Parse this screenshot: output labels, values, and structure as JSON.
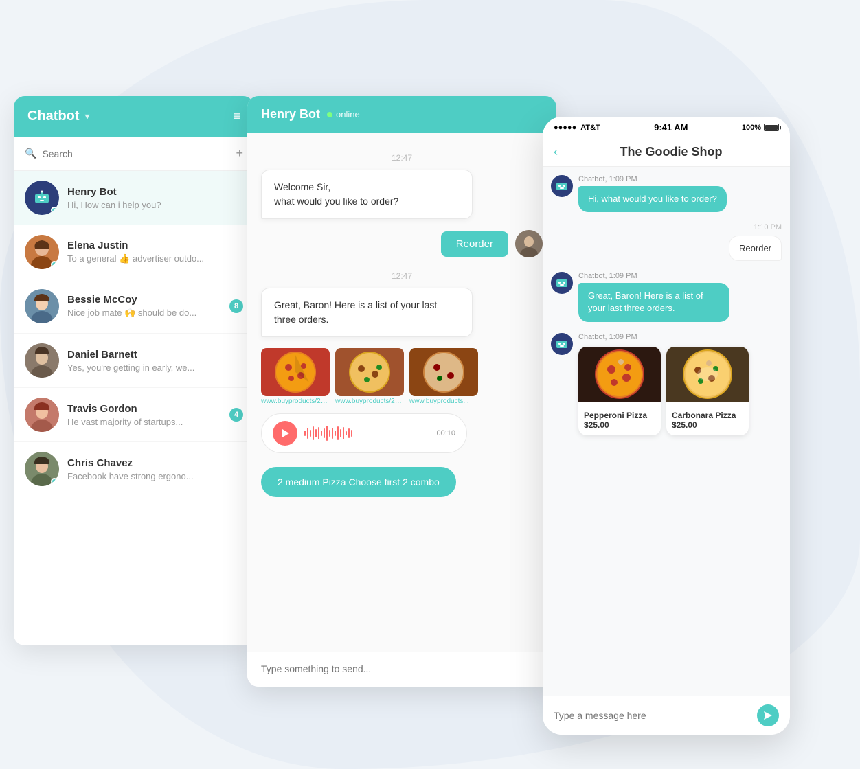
{
  "app": {
    "title": "Chatbot",
    "chevron": "▾",
    "menu_icon": "≡"
  },
  "search": {
    "placeholder": "Search"
  },
  "contacts": [
    {
      "id": "henry-bot",
      "name": "Henry Bot",
      "preview": "Hi, How can i help you?",
      "avatar_type": "bot",
      "online": true,
      "badge": null
    },
    {
      "id": "elena-justin",
      "name": "Elena Justin",
      "preview": "To a general 👍 advertiser outdo...",
      "avatar_type": "elena",
      "online": true,
      "badge": null
    },
    {
      "id": "bessie-mccoy",
      "name": "Bessie McCoy",
      "preview": "Nice job mate 🙌 should be do...",
      "avatar_type": "bessie",
      "online": false,
      "badge": 8
    },
    {
      "id": "daniel-barnett",
      "name": "Daniel Barnett",
      "preview": "Yes, you're getting in early, we...",
      "avatar_type": "daniel",
      "online": false,
      "badge": null
    },
    {
      "id": "travis-gordon",
      "name": "Travis Gordon",
      "preview": "He vast majority of startups...",
      "avatar_type": "travis",
      "online": false,
      "badge": 4
    },
    {
      "id": "chris-chavez",
      "name": "Chris Chavez",
      "preview": "Facebook have strong ergono...",
      "avatar_type": "chris",
      "online": true,
      "badge": null
    }
  ],
  "chat": {
    "bot_name": "Henry Bot",
    "status": "online",
    "timestamp": "12:47",
    "msg1": "Welcome Sir,\nwhat would you like to order?",
    "msg2": "Great, Baron! Here is a list of your last three orders.",
    "reorder_label": "Reorder",
    "audio_time": "00:10",
    "order_text": "2 medium Pizza Choose first 2 combo",
    "input_placeholder": "Type something to send..."
  },
  "phone": {
    "carrier": "AT&T",
    "time": "9:41 AM",
    "battery": "100%",
    "app_title": "The Goodie Shop",
    "msg1_sender": "Chatbot, 1:09 PM",
    "msg1_text": "Hi, what would you like to order?",
    "msg2_time": "1:10 PM",
    "msg2_text": "Reorder",
    "msg3_sender": "Chatbot, 1:09 PM",
    "msg3_text": "Great, Baron! Here is a list of your last three orders.",
    "msg4_sender": "Chatbot, 1:09 PM",
    "pizza1_name": "Pepperoni Pizza",
    "pizza1_price": "$25.00",
    "pizza2_name": "Carbonara Pizza",
    "pizza2_price": "$25.00",
    "input_placeholder": "Type a message here"
  },
  "colors": {
    "teal": "#4ecdc4",
    "dark_blue": "#2c3e7a",
    "red": "#ff6b6b",
    "white": "#ffffff",
    "light_gray": "#f5f5f5"
  }
}
